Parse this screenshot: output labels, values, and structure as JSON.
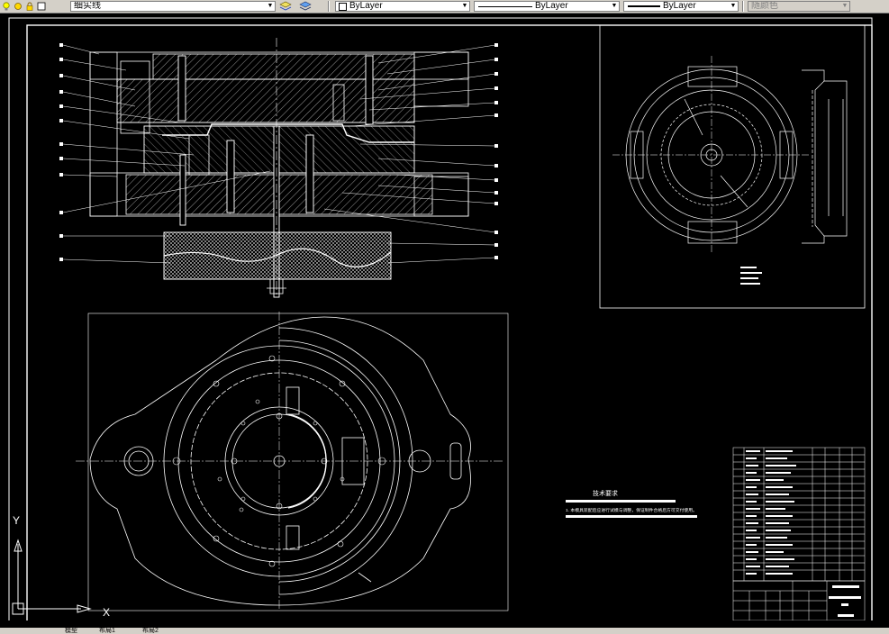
{
  "toolbar": {
    "layer_name": "细实线",
    "linetype_label": "ByLayer",
    "linetype2_label": "ByLayer",
    "lineweight_label": "ByLayer",
    "plotstyle_label": "随颜色"
  },
  "drawing": {
    "tech_req_title": "技术要求",
    "tech_req_line": "1. 本模具装配后应进行试模与调整，保证制件合格后方可交付使用。"
  },
  "ucs": {
    "y_label": "Y",
    "x_label": "X"
  },
  "statusbar": {
    "tab_model": "模型",
    "tab_layout1": "布局1",
    "tab_layout2": "布局2"
  },
  "colors": {
    "background": "#000000",
    "geometry": "#ffffff",
    "toolbar": "#d4d0c8"
  }
}
